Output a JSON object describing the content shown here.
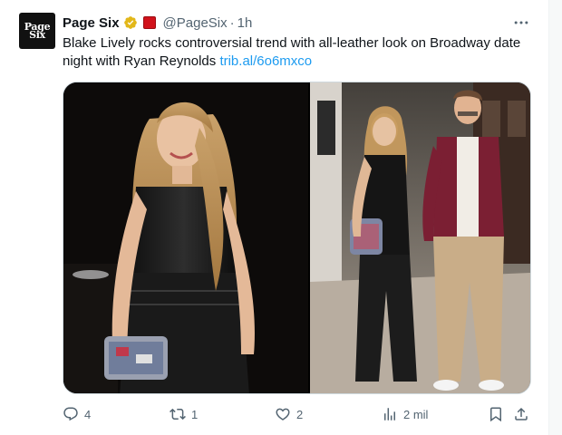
{
  "account": {
    "avatar_line1": "Page",
    "avatar_line2": "Six",
    "display_name": "Page Six",
    "handle": "@PageSix",
    "separator": "·",
    "time": "1h",
    "verified_color": "#e2b719"
  },
  "tweet": {
    "text": "Blake Lively rocks controversial trend with all-leather look on Broadway date night with Ryan Reynolds ",
    "link": "trib.al/6o6mxco"
  },
  "media": {
    "photos": [
      "photo-left",
      "photo-right"
    ]
  },
  "actions": {
    "replies": "4",
    "reposts": "1",
    "likes": "2",
    "views": "2 mil"
  },
  "colors": {
    "accent": "#1d9bf0",
    "muted": "#536471",
    "text": "#0f1419"
  },
  "icons": {
    "reply": "reply-icon",
    "repost": "repost-icon",
    "like": "heart-icon",
    "views": "views-icon",
    "bookmark": "bookmark-icon",
    "share": "share-icon",
    "more": "more-icon"
  }
}
